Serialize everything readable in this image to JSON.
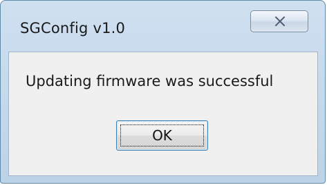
{
  "dialog": {
    "title": "SGConfig v1.0",
    "message": "Updating firmware was successful",
    "ok_label": "OK",
    "close_icon": "close-icon"
  },
  "colors": {
    "frame": "#bcd3e8",
    "content_bg": "#f0f0f0",
    "focus_border": "#3c7fb1"
  }
}
